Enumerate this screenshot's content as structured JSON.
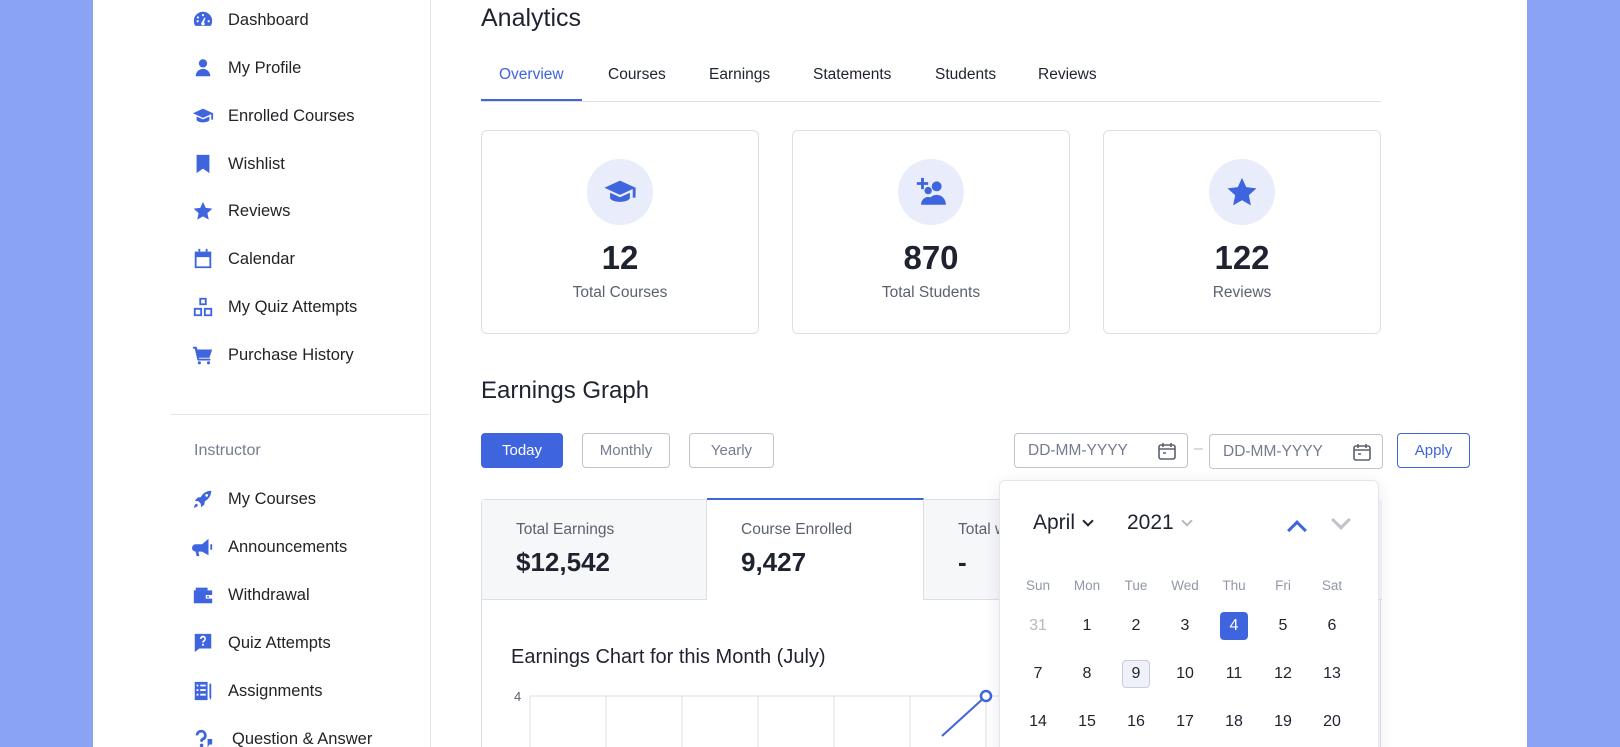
{
  "sidebar": {
    "items": [
      {
        "label": "Dashboard",
        "icon": "dashboard-icon"
      },
      {
        "label": "My Profile",
        "icon": "user-icon"
      },
      {
        "label": "Enrolled Courses",
        "icon": "graduation-cap-icon"
      },
      {
        "label": "Wishlist",
        "icon": "bookmark-icon"
      },
      {
        "label": "Reviews",
        "icon": "star-icon"
      },
      {
        "label": "Calendar",
        "icon": "calendar-icon"
      },
      {
        "label": "My Quiz Attempts",
        "icon": "quiz-blocks-icon"
      },
      {
        "label": "Purchase History",
        "icon": "cart-icon"
      }
    ],
    "instructor_heading": "Instructor",
    "instructor_items": [
      {
        "label": "My Courses",
        "icon": "rocket-icon"
      },
      {
        "label": "Announcements",
        "icon": "megaphone-icon"
      },
      {
        "label": "Withdrawal",
        "icon": "wallet-icon"
      },
      {
        "label": "Quiz Attempts",
        "icon": "question-icon"
      },
      {
        "label": "Assignments",
        "icon": "assignment-icon"
      },
      {
        "label": "Question & Answer",
        "icon": "qa-icon"
      }
    ]
  },
  "main": {
    "title": "Analytics",
    "tabs": [
      {
        "label": "Overview",
        "active": true
      },
      {
        "label": "Courses"
      },
      {
        "label": "Earnings"
      },
      {
        "label": "Statements"
      },
      {
        "label": "Students"
      },
      {
        "label": "Reviews"
      }
    ],
    "stats": [
      {
        "value": "12",
        "label": "Total Courses",
        "icon": "graduation-cap-icon"
      },
      {
        "value": "870",
        "label": "Total Students",
        "icon": "add-students-icon"
      },
      {
        "value": "122",
        "label": "Reviews",
        "icon": "star-icon"
      }
    ],
    "earnings_title": "Earnings Graph",
    "filters": {
      "today": "Today",
      "monthly": "Monthly",
      "yearly": "Yearly",
      "apply": "Apply"
    },
    "date_placeholder": "DD-MM-YYYY",
    "date_separator": "–",
    "earning_tabs": [
      {
        "label": "Total Earnings",
        "value": "$12,542"
      },
      {
        "label": "Course Enrolled",
        "value": "9,427"
      },
      {
        "label": "Total w",
        "value": "-"
      }
    ],
    "chart_title": "Earnings Chart for this Month (July)"
  },
  "chart_data": {
    "type": "line",
    "title": "Earnings Chart for this Month (July)",
    "y_tick_labels": [
      "4"
    ],
    "ylim": [
      0,
      4
    ],
    "grid": true,
    "series": [
      {
        "values": [
          {
            "x": 6,
            "y": 4
          }
        ]
      }
    ]
  },
  "calendar": {
    "month": "April",
    "year": "2021",
    "weekdays": [
      "Sun",
      "Mon",
      "Tue",
      "Wed",
      "Thu",
      "Fri",
      "Sat"
    ],
    "weeks": [
      [
        "31",
        "1",
        "2",
        "3",
        "4",
        "5",
        "6"
      ],
      [
        "7",
        "8",
        "9",
        "10",
        "11",
        "12",
        "13"
      ],
      [
        "14",
        "15",
        "16",
        "17",
        "18",
        "19",
        "20"
      ]
    ],
    "selected_day": "4",
    "today_day": "9",
    "muted_day": "31"
  },
  "colors": {
    "accent": "#3e64de",
    "background": "#8aa3f4"
  }
}
